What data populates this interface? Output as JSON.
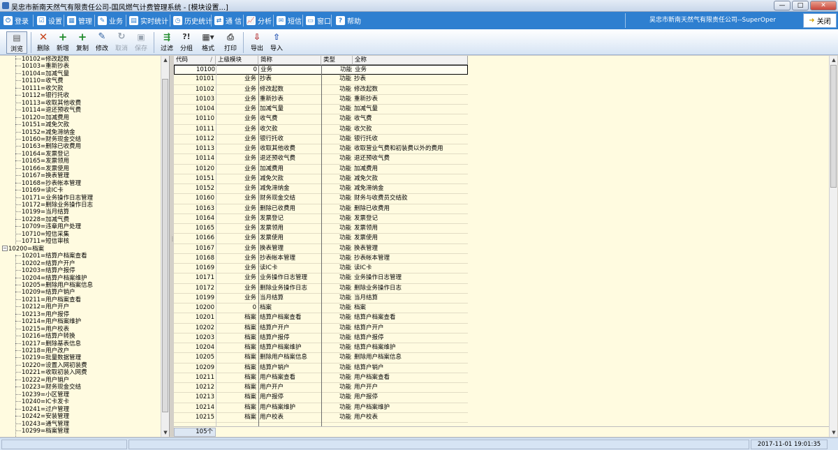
{
  "window": {
    "title": "吴忠市新南天然气有限责任公司-国风燃气计费管理系统 - [模块设置...]",
    "min_label": "—",
    "max_label": "□",
    "close_label": "✕"
  },
  "menu": {
    "items": [
      {
        "label": "登录",
        "icon": "login-icon"
      },
      {
        "label": "设置",
        "icon": "settings-icon"
      },
      {
        "label": "管理",
        "icon": "manage-icon"
      },
      {
        "label": "业务",
        "icon": "business-icon"
      },
      {
        "label": "实时统计",
        "icon": "realtime-stats-icon"
      },
      {
        "label": "历史统计",
        "icon": "history-stats-icon"
      },
      {
        "label": "通 信",
        "icon": "communication-icon"
      },
      {
        "label": "分析",
        "icon": "analysis-icon"
      },
      {
        "label": "短信",
        "icon": "sms-icon"
      },
      {
        "label": "窗口",
        "icon": "window-icon"
      },
      {
        "label": "帮助",
        "icon": "help-icon"
      }
    ],
    "company_user": "吴忠市新南天然气有限责任公司--SuperOper",
    "close_label": "关闭"
  },
  "toolbar": {
    "browse": "浏览",
    "delete": "删除",
    "add": "新增",
    "copy": "复制",
    "edit": "修改",
    "cancel": "取消",
    "save": "保存",
    "filter": "过滤",
    "group": "分组",
    "format": "格式",
    "print": "打印",
    "export": "导出",
    "import": "导入"
  },
  "tree": {
    "items": [
      {
        "text": "10102=修改起数",
        "level": 1
      },
      {
        "text": "10103=重新抄表",
        "level": 1
      },
      {
        "text": "10104=加减气量",
        "level": 1
      },
      {
        "text": "10110=收气费",
        "level": 1
      },
      {
        "text": "10111=收欠款",
        "level": 1
      },
      {
        "text": "10112=银行托收",
        "level": 1
      },
      {
        "text": "10113=收取其他收费",
        "level": 1
      },
      {
        "text": "10114=退还预收气费",
        "level": 1
      },
      {
        "text": "10120=加减费用",
        "level": 1
      },
      {
        "text": "10151=减免欠款",
        "level": 1
      },
      {
        "text": "10152=减免滞纳金",
        "level": 1
      },
      {
        "text": "10160=财务现金交结",
        "level": 1
      },
      {
        "text": "10163=删除已收费用",
        "level": 1
      },
      {
        "text": "10164=发票登记",
        "level": 1
      },
      {
        "text": "10165=发票领用",
        "level": 1
      },
      {
        "text": "10166=发票使用",
        "level": 1
      },
      {
        "text": "10167=换表管理",
        "level": 1
      },
      {
        "text": "10168=抄表帐本管理",
        "level": 1
      },
      {
        "text": "10169=读IC卡",
        "level": 1
      },
      {
        "text": "10171=业务操作日志管理",
        "level": 1
      },
      {
        "text": "10172=删除业务操作日志",
        "level": 1
      },
      {
        "text": "10199=当月结算",
        "level": 1
      },
      {
        "text": "10228=加减气费",
        "level": 1
      },
      {
        "text": "10709=违章用户处理",
        "level": 1
      },
      {
        "text": "10710=短信采集",
        "level": 1
      },
      {
        "text": "10711=短信审核",
        "level": 1
      },
      {
        "text": "10200=档案",
        "level": 0,
        "expander": "−"
      },
      {
        "text": "10201=结算户档案查看",
        "level": 1
      },
      {
        "text": "10202=结算户开户",
        "level": 1
      },
      {
        "text": "10203=结算户报停",
        "level": 1
      },
      {
        "text": "10204=结算户档案维护",
        "level": 1
      },
      {
        "text": "10205=删除用户档案信息",
        "level": 1
      },
      {
        "text": "10209=结算户销户",
        "level": 1
      },
      {
        "text": "10211=用户档案查看",
        "level": 1
      },
      {
        "text": "10212=用户开户",
        "level": 1
      },
      {
        "text": "10213=用户报停",
        "level": 1
      },
      {
        "text": "10214=用户档案维护",
        "level": 1
      },
      {
        "text": "10215=用户校表",
        "level": 1
      },
      {
        "text": "10216=结算户转换",
        "level": 1
      },
      {
        "text": "10217=删除基表信息",
        "level": 1
      },
      {
        "text": "10218=用户改户",
        "level": 1
      },
      {
        "text": "10219=批量数据管理",
        "level": 1
      },
      {
        "text": "10220=设置入网初装费",
        "level": 1
      },
      {
        "text": "10221=收取初装入网费",
        "level": 1
      },
      {
        "text": "10222=用户销户",
        "level": 1
      },
      {
        "text": "10223=财务现金交结",
        "level": 1
      },
      {
        "text": "10239=小区管理",
        "level": 1
      },
      {
        "text": "10240=IC卡发卡",
        "level": 1
      },
      {
        "text": "10241=过户管理",
        "level": 1
      },
      {
        "text": "10242=安装管理",
        "level": 1
      },
      {
        "text": "10243=通气管理",
        "level": 1
      },
      {
        "text": "10299=档案管理",
        "level": 1
      }
    ]
  },
  "grid": {
    "headers": {
      "code": "代码",
      "sort": "/",
      "parent": "上级模块",
      "short": "简称",
      "type": "类型",
      "full": "全称"
    },
    "rows": [
      {
        "code": "10100",
        "parent": "0",
        "short": "业务",
        "type": "功能",
        "full": "业务"
      },
      {
        "code": "10101",
        "parent": "业务",
        "short": "抄表",
        "type": "功能",
        "full": "抄表"
      },
      {
        "code": "10102",
        "parent": "业务",
        "short": "修改起数",
        "type": "功能",
        "full": "修改起数"
      },
      {
        "code": "10103",
        "parent": "业务",
        "short": "重新抄表",
        "type": "功能",
        "full": "重新抄表"
      },
      {
        "code": "10104",
        "parent": "业务",
        "short": "加减气量",
        "type": "功能",
        "full": "加减气量"
      },
      {
        "code": "10110",
        "parent": "业务",
        "short": "收气费",
        "type": "功能",
        "full": "收气费"
      },
      {
        "code": "10111",
        "parent": "业务",
        "short": "收欠款",
        "type": "功能",
        "full": "收欠款"
      },
      {
        "code": "10112",
        "parent": "业务",
        "short": "银行托收",
        "type": "功能",
        "full": "银行托收"
      },
      {
        "code": "10113",
        "parent": "业务",
        "short": "收取其他收费",
        "type": "功能",
        "full": "收取营业气费和初装费以外的费用"
      },
      {
        "code": "10114",
        "parent": "业务",
        "short": "退还预收气费",
        "type": "功能",
        "full": "退还预收气费"
      },
      {
        "code": "10120",
        "parent": "业务",
        "short": "加减费用",
        "type": "功能",
        "full": "加减费用"
      },
      {
        "code": "10151",
        "parent": "业务",
        "short": "减免欠款",
        "type": "功能",
        "full": "减免欠款"
      },
      {
        "code": "10152",
        "parent": "业务",
        "short": "减免滞纳金",
        "type": "功能",
        "full": "减免滞纳金"
      },
      {
        "code": "10160",
        "parent": "业务",
        "short": "财务现金交结",
        "type": "功能",
        "full": "财务与收费员交结款"
      },
      {
        "code": "10163",
        "parent": "业务",
        "short": "删除已收费用",
        "type": "功能",
        "full": "删除已收费用"
      },
      {
        "code": "10164",
        "parent": "业务",
        "short": "发票登记",
        "type": "功能",
        "full": "发票登记"
      },
      {
        "code": "10165",
        "parent": "业务",
        "short": "发票领用",
        "type": "功能",
        "full": "发票领用"
      },
      {
        "code": "10166",
        "parent": "业务",
        "short": "发票使用",
        "type": "功能",
        "full": "发票使用"
      },
      {
        "code": "10167",
        "parent": "业务",
        "short": "换表管理",
        "type": "功能",
        "full": "换表管理"
      },
      {
        "code": "10168",
        "parent": "业务",
        "short": "抄表帐本管理",
        "type": "功能",
        "full": "抄表帐本管理"
      },
      {
        "code": "10169",
        "parent": "业务",
        "short": "读IC卡",
        "type": "功能",
        "full": "读IC卡"
      },
      {
        "code": "10171",
        "parent": "业务",
        "short": "业务操作日志管理",
        "type": "功能",
        "full": "业务操作日志管理"
      },
      {
        "code": "10172",
        "parent": "业务",
        "short": "删除业务操作日志",
        "type": "功能",
        "full": "删除业务操作日志"
      },
      {
        "code": "10199",
        "parent": "业务",
        "short": "当月结算",
        "type": "功能",
        "full": "当月结算"
      },
      {
        "code": "10200",
        "parent": "0",
        "short": "档案",
        "type": "功能",
        "full": "档案"
      },
      {
        "code": "10201",
        "parent": "档案",
        "short": "结算户档案查看",
        "type": "功能",
        "full": "结算户档案查看"
      },
      {
        "code": "10202",
        "parent": "档案",
        "short": "结算户开户",
        "type": "功能",
        "full": "结算户开户"
      },
      {
        "code": "10203",
        "parent": "档案",
        "short": "结算户报停",
        "type": "功能",
        "full": "结算户报停"
      },
      {
        "code": "10204",
        "parent": "档案",
        "short": "结算户档案维护",
        "type": "功能",
        "full": "结算户档案维护"
      },
      {
        "code": "10205",
        "parent": "档案",
        "short": "删除用户档案信息",
        "type": "功能",
        "full": "删除用户档案信息"
      },
      {
        "code": "10209",
        "parent": "档案",
        "short": "结算户销户",
        "type": "功能",
        "full": "结算户销户"
      },
      {
        "code": "10211",
        "parent": "档案",
        "short": "用户档案查看",
        "type": "功能",
        "full": "用户档案查看"
      },
      {
        "code": "10212",
        "parent": "档案",
        "short": "用户开户",
        "type": "功能",
        "full": "用户开户"
      },
      {
        "code": "10213",
        "parent": "档案",
        "short": "用户报停",
        "type": "功能",
        "full": "用户报停"
      },
      {
        "code": "10214",
        "parent": "档案",
        "short": "用户档案维护",
        "type": "功能",
        "full": "用户档案维护"
      },
      {
        "code": "10215",
        "parent": "档案",
        "short": "用户校表",
        "type": "功能",
        "full": "用户校表"
      }
    ],
    "count": "105个"
  },
  "status": {
    "datetime": "2017-11-01  19:01:35"
  },
  "colors": {
    "menubar": "#2e7fd0",
    "pane_bg": "#fffbe0",
    "toolbar_gradient_end": "#d6e4f4"
  }
}
